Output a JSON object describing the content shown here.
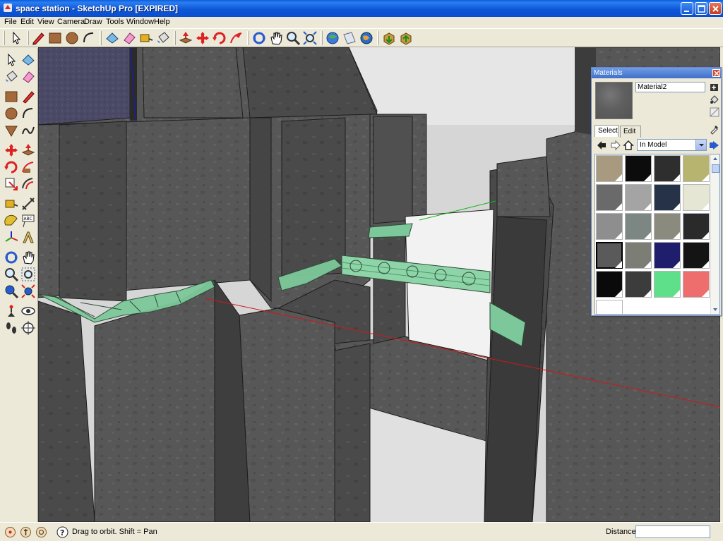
{
  "window": {
    "title": "space station - SketchUp Pro [EXPIRED]",
    "controls": [
      "minimize",
      "maximize",
      "close"
    ]
  },
  "menubar": {
    "items": [
      {
        "label": "File"
      },
      {
        "label": "Edit"
      },
      {
        "label": "View"
      },
      {
        "label": "Camera"
      },
      {
        "label": "Draw"
      },
      {
        "label": "Tools"
      },
      {
        "label": "Window"
      },
      {
        "label": "Help"
      }
    ]
  },
  "toolbar_top": {
    "tools": [
      "select-icon",
      "pencil-icon",
      "rectangle-icon",
      "circle-icon",
      "arc-icon",
      "make-component-icon",
      "eraser-icon",
      "tape-measure-icon",
      "paint-bucket-icon",
      "push-pull-icon",
      "move-icon",
      "rotate-icon",
      "follow-me-icon",
      "orbit-icon",
      "pan-icon",
      "zoom-icon",
      "zoom-extents-icon",
      "get-models-icon",
      "share-model-icon",
      "google-earth-icon",
      "get-components-icon",
      "share-component-icon"
    ]
  },
  "toolbar_left": {
    "tools": [
      "select-icon",
      "make-component-icon",
      "paint-bucket-icon",
      "eraser-icon",
      "rectangle-icon",
      "line-icon",
      "circle-icon",
      "arc-icon",
      "polygon-icon",
      "freehand-icon",
      "move-icon",
      "push-pull-icon",
      "rotate-icon",
      "follow-me-icon",
      "scale-icon",
      "offset-icon",
      "tape-measure-icon",
      "dimension-icon",
      "protractor-icon",
      "text-icon",
      "axes-icon",
      "3d-text-icon",
      "orbit-icon",
      "pan-icon",
      "zoom-icon",
      "zoom-window-icon",
      "previous-view-icon",
      "zoom-extents-icon",
      "position-camera-icon",
      "look-around-icon",
      "walk-icon",
      "section-plane-icon"
    ]
  },
  "materials_panel": {
    "title": "Materials",
    "material_name": "Material2",
    "tabs": [
      {
        "label": "Select",
        "active": true
      },
      {
        "label": "Edit",
        "active": false
      }
    ],
    "collection": "In Model",
    "swatches": [
      "#a89a7e",
      "#0c0c0c",
      "#2e2e2e",
      "#b7b470",
      "#6a6a6a",
      "#a4a4a4",
      "#253248",
      "#e6e6d4",
      "#8e8e8e",
      "#7c8682",
      "#8a8a7e",
      "#2a2a2a",
      "#5a5a5a",
      "#7c7e76",
      "#1e1e6c",
      "#141414",
      "#0a0a0a",
      "#3c3c3c",
      "#5ee08a",
      "#ee6e6e",
      "#ffffff"
    ],
    "selected_index": 12
  },
  "statusbar": {
    "hint": "Drag to orbit.  Shift = Pan",
    "vcb_label": "Distance",
    "vcb_value": ""
  },
  "colors": {
    "titlebar": "#0a5fdc",
    "chrome": "#ece9d8",
    "model_gray": "#5a5a5a",
    "glass_green": "#7dc89a",
    "sky": "#e6e6e6",
    "axis_red": "#d01818",
    "axis_green": "#18b418",
    "axis_blue": "#1818c8"
  }
}
